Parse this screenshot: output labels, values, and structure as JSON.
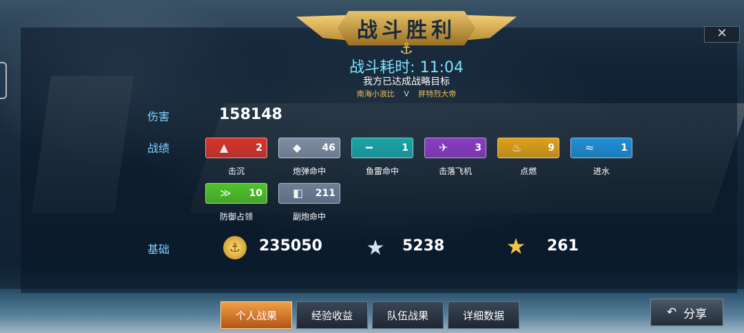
{
  "header": {
    "title": "战斗胜利",
    "close_glyph": "✕"
  },
  "battle": {
    "time_label": "战斗耗时: 11:04",
    "result_text": "我方已达成战略目标",
    "player_left": "南海小浪比",
    "vs": "V",
    "player_right": "胖特烈大帝"
  },
  "labels": {
    "damage": "伤害",
    "achievements": "战绩",
    "base": "基础"
  },
  "damage_value": "158148",
  "achievements": [
    {
      "name": "击沉",
      "count": "2",
      "color": "#d8352a",
      "icon": "sunk-ship-icon",
      "glyph": "▲"
    },
    {
      "name": "炮弹命中",
      "count": "46",
      "color": "#7f8ea4",
      "icon": "shell-hit-icon",
      "glyph": "◆"
    },
    {
      "name": "鱼雷命中",
      "count": "1",
      "color": "#1aa6a8",
      "icon": "torpedo-hit-icon",
      "glyph": "━"
    },
    {
      "name": "击落飞机",
      "count": "3",
      "color": "#8a3cc4",
      "icon": "plane-shot-icon",
      "glyph": "✈"
    },
    {
      "name": "点燃",
      "count": "9",
      "color": "#e0a018",
      "icon": "fire-icon",
      "glyph": "♨"
    },
    {
      "name": "进水",
      "count": "1",
      "color": "#1e8fd6",
      "icon": "flooding-icon",
      "glyph": "≈"
    },
    {
      "name": "防御占领",
      "count": "10",
      "color": "#4fc42a",
      "icon": "defend-capture-icon",
      "glyph": "≫"
    },
    {
      "name": "副炮命中",
      "count": "211",
      "color": "#6f7f96",
      "icon": "secondary-gun-hit-icon",
      "glyph": "◧"
    }
  ],
  "base": {
    "coins": {
      "value": "235050",
      "icon": "gold-coin-icon",
      "glyph": "⚓"
    },
    "xp": {
      "value": "5238",
      "icon": "silver-star-icon",
      "glyph": "★"
    },
    "commander_xp": {
      "value": "261",
      "icon": "gold-star-icon",
      "glyph": "★"
    }
  },
  "tabs": [
    "个人战果",
    "经验收益",
    "队伍战果",
    "详细数据"
  ],
  "active_tab": 0,
  "share": {
    "label": "分享",
    "glyph": "↶"
  }
}
